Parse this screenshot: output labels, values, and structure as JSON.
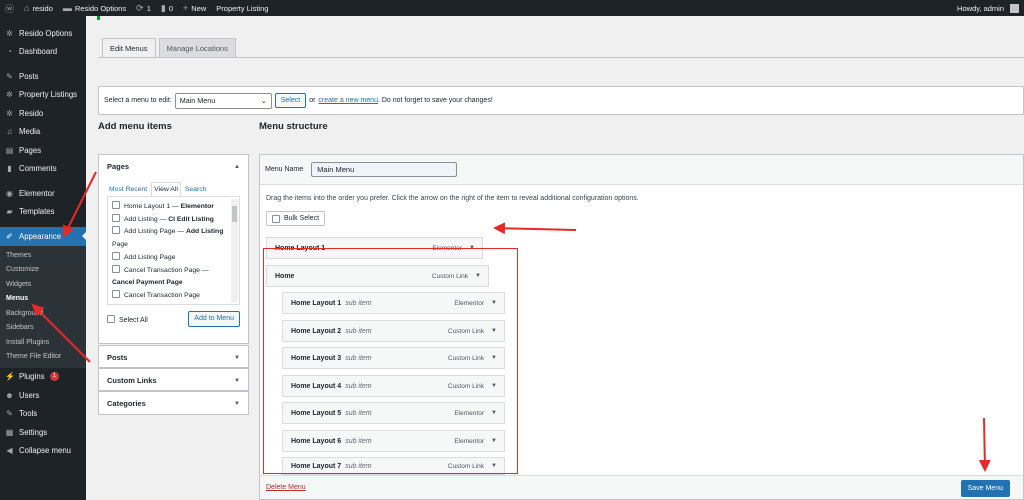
{
  "adminbar": {
    "site_name": "resido",
    "options_label": "Resido Options",
    "updates_count": "1",
    "comments_count": "0",
    "new_label": "New",
    "property_listing": "Property Listing",
    "howdy": "Howdy, admin"
  },
  "sidebar": {
    "items": [
      {
        "label": "Resido Options",
        "icon": "gear-icon"
      },
      {
        "label": "Dashboard",
        "icon": "dashboard-icon"
      },
      {
        "label": "Posts",
        "icon": "pin-icon"
      },
      {
        "label": "Property Listings",
        "icon": "gear-icon"
      },
      {
        "label": "Resido",
        "icon": "gear-icon"
      },
      {
        "label": "Media",
        "icon": "media-icon"
      },
      {
        "label": "Pages",
        "icon": "page-icon"
      },
      {
        "label": "Comments",
        "icon": "comment-icon"
      },
      {
        "label": "Elementor",
        "icon": "elementor-icon"
      },
      {
        "label": "Templates",
        "icon": "folder-icon"
      },
      {
        "label": "Appearance",
        "icon": "brush-icon"
      },
      {
        "label": "Plugins",
        "icon": "plugin-icon",
        "badge": "1"
      },
      {
        "label": "Users",
        "icon": "users-icon"
      },
      {
        "label": "Tools",
        "icon": "wrench-icon"
      },
      {
        "label": "Settings",
        "icon": "settings-icon"
      },
      {
        "label": "Collapse menu",
        "icon": "collapse-icon"
      }
    ],
    "submenu": [
      "Themes",
      "Customize",
      "Widgets",
      "Menus",
      "Background",
      "Sidebars",
      "Install Plugins",
      "Theme File Editor"
    ]
  },
  "tabs": {
    "edit": "Edit Menus",
    "manage": "Manage Locations"
  },
  "select_bar": {
    "label": "Select a menu to edit:",
    "selected": "Main Menu",
    "select_btn": "Select",
    "or": "or",
    "create_link": "create a new menu",
    "after": ". Do not forget to save your changes!"
  },
  "add_items": {
    "title": "Add menu items",
    "pages_label": "Pages",
    "tabs": [
      "Most Recent",
      "View All",
      "Search"
    ],
    "pages": [
      {
        "pre": "Home Layout 1 — ",
        "bold": "Elementor",
        "post": ""
      },
      {
        "pre": "Add Listing — ",
        "bold": "Cl Edit Listing",
        "post": ""
      },
      {
        "pre": "Add Listing Page — ",
        "bold": "Add Listing",
        "post": "Page"
      },
      {
        "pre": "Add Listing Page",
        "bold": "",
        "post": ""
      },
      {
        "pre": "Cancel Transaction Page —",
        "bold": "",
        "post": "Cancel Payment Page"
      },
      {
        "pre": "Cancel Transaction Page",
        "bold": "",
        "post": ""
      }
    ],
    "select_all": "Select All",
    "add_btn": "Add to Menu",
    "posts": "Posts",
    "custom_links": "Custom Links",
    "categories": "Categories"
  },
  "structure": {
    "title": "Menu structure",
    "name_label": "Menu Name",
    "name_value": "Main Menu",
    "instructions": "Drag the items into the order you prefer. Click the arrow on the right of the item to reveal additional configuration options.",
    "bulk_select": "Bulk Select",
    "items": [
      {
        "title": "Home Layout 1",
        "sub": "",
        "type": "Elementor"
      },
      {
        "title": "Home",
        "sub": "",
        "type": "Custom Link"
      },
      {
        "title": "Home Layout 1",
        "sub": "sub item",
        "type": "Elementor"
      },
      {
        "title": "Home Layout 2",
        "sub": "sub item",
        "type": "Custom Link"
      },
      {
        "title": "Home Layout 3",
        "sub": "sub item",
        "type": "Custom Link"
      },
      {
        "title": "Home Layout 4",
        "sub": "sub item",
        "type": "Custom Link"
      },
      {
        "title": "Home Layout 5",
        "sub": "sub item",
        "type": "Elementor"
      },
      {
        "title": "Home Layout 6",
        "sub": "sub item",
        "type": "Elementor"
      },
      {
        "title": "Home Layout 7",
        "sub": "sub item",
        "type": "Custom Link"
      }
    ],
    "delete": "Delete Menu",
    "save": "Save Menu"
  },
  "colors": {
    "accent": "#2271b1",
    "annotation": "#e42a2a",
    "sidebar": "#1d2327"
  }
}
